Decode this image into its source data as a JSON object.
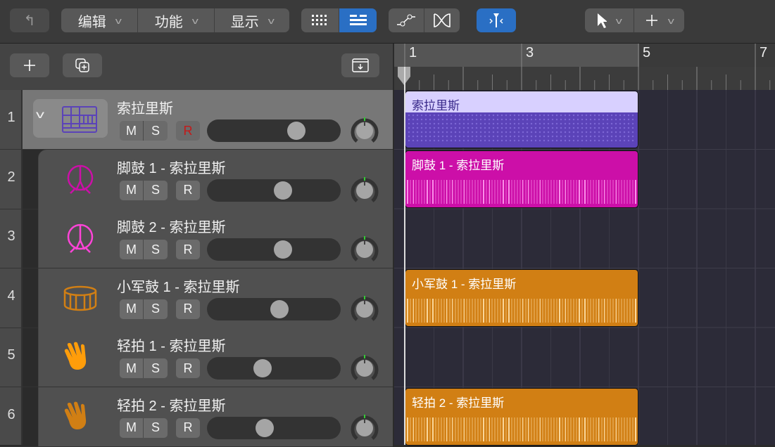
{
  "toolbar": {
    "back_icon": "back-arrow-icon",
    "menus": [
      {
        "label": "编辑"
      },
      {
        "label": "功能"
      },
      {
        "label": "显示"
      }
    ],
    "view_icons": [
      "grid-view-icon",
      "list-view-icon"
    ],
    "tool_icons": [
      "automation-icon",
      "crossfade-icon",
      "catch-playhead-icon",
      "pointer-tool-icon",
      "marquee-tool-icon"
    ]
  },
  "header": {
    "add_icon": "plus-icon",
    "duplicate_icon": "duplicate-track-icon",
    "download_icon": "download-icon"
  },
  "ruler": {
    "bars": [
      "1",
      "3",
      "5",
      "7"
    ]
  },
  "tracks": [
    {
      "num": "1",
      "name": "索拉里斯",
      "icon": "drum-machine-icon",
      "m": "M",
      "s": "S",
      "r": "R",
      "volume": 0.7,
      "region": "索拉里斯",
      "color": "#5b43b8"
    },
    {
      "num": "2",
      "name": "脚鼓 1 - 索拉里斯",
      "icon": "kick-drum-icon",
      "m": "M",
      "s": "S",
      "r": "R",
      "volume": 0.58,
      "region": "脚鼓 1 - 索拉里斯",
      "color": "#cc0fa8"
    },
    {
      "num": "3",
      "name": "脚鼓 2 - 索拉里斯",
      "icon": "kick-drum-icon",
      "m": "M",
      "s": "S",
      "r": "R",
      "volume": 0.58,
      "region": "",
      "color": "#ff44d8"
    },
    {
      "num": "4",
      "name": "小军鼓 1 - 索拉里斯",
      "icon": "snare-drum-icon",
      "m": "M",
      "s": "S",
      "r": "R",
      "volume": 0.55,
      "region": "小军鼓 1 - 索拉里斯",
      "color": "#d17f14"
    },
    {
      "num": "5",
      "name": "轻拍 1 - 索拉里斯",
      "icon": "hand-clap-icon",
      "m": "M",
      "s": "S",
      "r": "R",
      "volume": 0.4,
      "region": "",
      "color": "#ff9d0a"
    },
    {
      "num": "6",
      "name": "轻拍 2 - 索拉里斯",
      "icon": "hand-clap-icon",
      "m": "M",
      "s": "S",
      "r": "R",
      "volume": 0.42,
      "region": "轻拍 2 - 索拉里斯",
      "color": "#d17f14"
    }
  ]
}
